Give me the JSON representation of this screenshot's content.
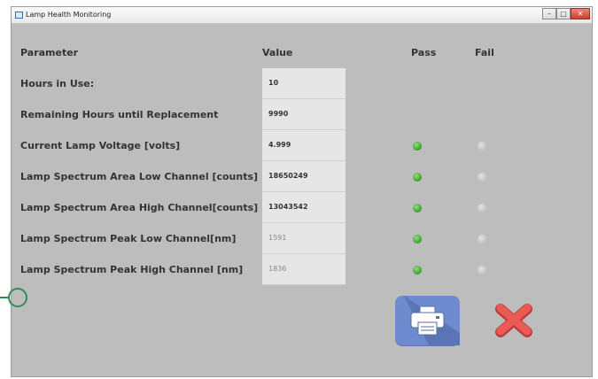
{
  "window": {
    "title": "Lamp Health Monitoring"
  },
  "headers": {
    "parameter": "Parameter",
    "value": "Value",
    "pass": "Pass",
    "fail": "Fail"
  },
  "rows": [
    {
      "label": "Hours in Use:",
      "value": "10",
      "pass": null,
      "fail": null,
      "dim": false
    },
    {
      "label": "Remaining Hours until Replacement",
      "value": "9990",
      "pass": null,
      "fail": null,
      "dim": false
    },
    {
      "label": "Current Lamp Voltage [volts]",
      "value": "4.999",
      "pass": true,
      "fail": false,
      "dim": false
    },
    {
      "label": "Lamp Spectrum Area  Low Channel [counts]",
      "value": "18650249",
      "pass": true,
      "fail": false,
      "dim": false
    },
    {
      "label": "Lamp Spectrum Area  High Channel[counts]",
      "value": "13043542",
      "pass": true,
      "fail": false,
      "dim": false
    },
    {
      "label": "Lamp Spectrum Peak Low Channel[nm]",
      "value": "1591",
      "pass": true,
      "fail": false,
      "dim": true
    },
    {
      "label": "Lamp Spectrum Peak High Channel [nm]",
      "value": "1836",
      "pass": true,
      "fail": false,
      "dim": true
    }
  ],
  "colors": {
    "pass_on": "#3c9c2c",
    "indicator_off": "#c4c4c4",
    "print_button": "#6f8bd0",
    "cancel_x": "#e0433f"
  },
  "icons": {
    "print": "printer-icon",
    "cancel": "close-x-icon"
  }
}
